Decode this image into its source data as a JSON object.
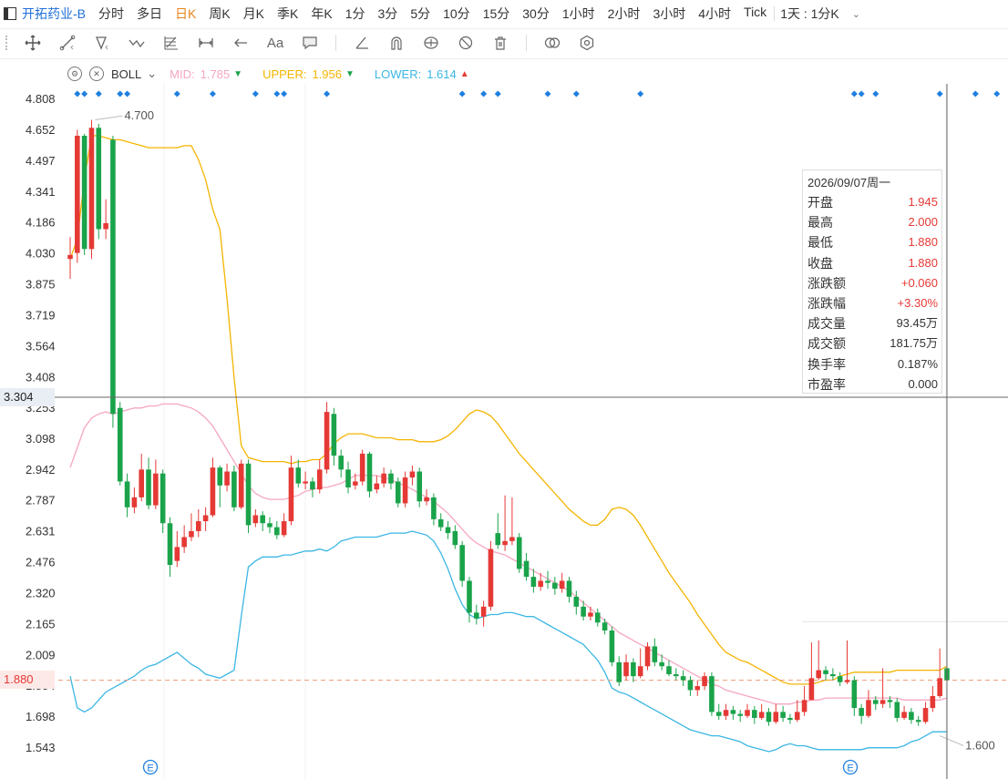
{
  "header": {
    "stock_name": "开拓药业-B",
    "periods": [
      "分时",
      "多日",
      "日K",
      "周K",
      "月K",
      "季K",
      "年K",
      "1分",
      "3分",
      "5分",
      "10分",
      "15分",
      "30分",
      "1小时",
      "2小时",
      "3小时",
      "4小时",
      "Tick"
    ],
    "active_period": "日K",
    "period_selector": "1天 : 1分K"
  },
  "toolbar": {
    "icons": [
      "crosshair-icon",
      "line-tool-icon",
      "shape-tool-icon",
      "wave-tool-icon",
      "fib-tool-icon",
      "measure-tool-icon",
      "arrow-tool-icon",
      "text-tool-icon",
      "comment-tool-icon",
      "angle-tool-icon",
      "magnet-icon",
      "lock-icon",
      "hide-icon",
      "trash-icon",
      "compare-icon",
      "settings-icon"
    ],
    "text_tool_label": "Aa"
  },
  "indicator": {
    "name": "BOLL",
    "mid_label": "MID:",
    "mid_value": "1.785",
    "upper_label": "UPPER:",
    "upper_value": "1.956",
    "lower_label": "LOWER:",
    "lower_value": "1.614",
    "mid_color": "#f5a7c0",
    "upper_color": "#f4b400",
    "lower_color": "#3bb6e3"
  },
  "infobox": {
    "date": "2026/09/07周一",
    "rows": [
      {
        "label": "开盘",
        "value": "1.945",
        "color": "#e53935"
      },
      {
        "label": "最高",
        "value": "2.000",
        "color": "#e53935"
      },
      {
        "label": "最低",
        "value": "1.880",
        "color": "#e53935"
      },
      {
        "label": "收盘",
        "value": "1.880",
        "color": "#e53935"
      },
      {
        "label": "涨跌额",
        "value": "+0.060",
        "color": "#e53935"
      },
      {
        "label": "涨跌幅",
        "value": "+3.30%",
        "color": "#e53935"
      },
      {
        "label": "成交量",
        "value": "93.45万",
        "color": "#333333"
      },
      {
        "label": "成交额",
        "value": "181.75万",
        "color": "#333333"
      },
      {
        "label": "换手率",
        "value": "0.187%",
        "color": "#333333"
      },
      {
        "label": "市盈率",
        "value": "0.000",
        "color": "#333333"
      }
    ]
  },
  "crosshair": {
    "price_label": "3.304",
    "last_price_label": "1.880"
  },
  "colors": {
    "up": "#e53935",
    "down": "#1aa34a",
    "accent": "#1e6fd9",
    "active_period": "#e8841a"
  },
  "chart_data": {
    "type": "candlestick",
    "y_tick_labels": [
      "4.808",
      "4.652",
      "4.497",
      "4.341",
      "4.186",
      "4.030",
      "3.875",
      "3.719",
      "3.564",
      "3.408",
      "3.253",
      "3.098",
      "2.942",
      "2.787",
      "2.631",
      "2.476",
      "2.320",
      "2.165",
      "2.009",
      "1.854",
      "1.698",
      "1.543"
    ],
    "ylim": [
      1.5,
      4.87
    ],
    "high_annotation": "4.700",
    "low_annotation": "1.600",
    "event_marker_label": "E",
    "candles": [
      [
        4.0,
        4.02,
        4.11,
        3.9
      ],
      [
        4.03,
        4.62,
        4.65,
        3.98
      ],
      [
        4.62,
        4.05,
        4.63,
        4.02
      ],
      [
        4.05,
        4.66,
        4.7,
        4.0
      ],
      [
        4.66,
        4.15,
        4.68,
        4.1
      ],
      [
        4.15,
        4.18,
        4.3,
        4.1
      ],
      [
        4.6,
        3.22,
        4.62,
        3.15
      ],
      [
        3.25,
        2.88,
        3.28,
        2.86
      ],
      [
        2.88,
        2.75,
        2.92,
        2.7
      ],
      [
        2.75,
        2.8,
        2.85,
        2.72
      ],
      [
        2.8,
        2.94,
        3.02,
        2.78
      ],
      [
        2.94,
        2.76,
        3.0,
        2.74
      ],
      [
        2.76,
        2.92,
        2.99,
        2.74
      ],
      [
        2.92,
        2.67,
        2.94,
        2.62
      ],
      [
        2.67,
        2.46,
        2.7,
        2.4
      ],
      [
        2.48,
        2.55,
        2.63,
        2.45
      ],
      [
        2.55,
        2.6,
        2.66,
        2.52
      ],
      [
        2.6,
        2.63,
        2.72,
        2.58
      ],
      [
        2.63,
        2.68,
        2.74,
        2.6
      ],
      [
        2.68,
        2.71,
        2.75,
        2.63
      ],
      [
        2.71,
        2.95,
        3.0,
        2.7
      ],
      [
        2.95,
        2.86,
        2.96,
        2.75
      ],
      [
        2.86,
        2.93,
        2.97,
        2.83
      ],
      [
        2.93,
        2.75,
        2.96,
        2.73
      ],
      [
        2.75,
        2.97,
        2.99,
        2.74
      ],
      [
        2.97,
        2.66,
        2.99,
        2.62
      ],
      [
        2.67,
        2.71,
        2.74,
        2.65
      ],
      [
        2.71,
        2.67,
        2.73,
        2.63
      ],
      [
        2.67,
        2.65,
        2.7,
        2.62
      ],
      [
        2.65,
        2.61,
        2.68,
        2.59
      ],
      [
        2.61,
        2.68,
        2.72,
        2.6
      ],
      [
        2.68,
        2.95,
        3.01,
        2.66
      ],
      [
        2.95,
        2.87,
        2.99,
        2.85
      ],
      [
        2.87,
        2.88,
        2.93,
        2.84
      ],
      [
        2.88,
        2.84,
        2.9,
        2.8
      ],
      [
        2.84,
        2.94,
        2.99,
        2.82
      ],
      [
        2.94,
        3.23,
        3.28,
        2.92
      ],
      [
        3.22,
        3.01,
        3.25,
        2.96
      ],
      [
        3.01,
        2.94,
        3.04,
        2.9
      ],
      [
        2.94,
        2.85,
        2.98,
        2.82
      ],
      [
        2.86,
        2.88,
        2.92,
        2.84
      ],
      [
        2.88,
        3.02,
        3.04,
        2.86
      ],
      [
        3.02,
        2.83,
        3.03,
        2.8
      ],
      [
        2.84,
        2.87,
        2.91,
        2.82
      ],
      [
        2.87,
        2.92,
        2.95,
        2.85
      ],
      [
        2.92,
        2.87,
        2.94,
        2.84
      ],
      [
        2.88,
        2.77,
        2.9,
        2.75
      ],
      [
        2.77,
        2.9,
        2.93,
        2.75
      ],
      [
        2.9,
        2.93,
        2.96,
        2.86
      ],
      [
        2.93,
        2.78,
        2.95,
        2.75
      ],
      [
        2.78,
        2.8,
        2.84,
        2.76
      ],
      [
        2.8,
        2.69,
        2.82,
        2.66
      ],
      [
        2.69,
        2.65,
        2.72,
        2.63
      ],
      [
        2.65,
        2.62,
        2.68,
        2.59
      ],
      [
        2.63,
        2.56,
        2.66,
        2.54
      ],
      [
        2.56,
        2.38,
        2.58,
        2.35
      ],
      [
        2.38,
        2.22,
        2.4,
        2.17
      ],
      [
        2.22,
        2.19,
        2.26,
        2.16
      ],
      [
        2.2,
        2.25,
        2.28,
        2.15
      ],
      [
        2.25,
        2.54,
        2.58,
        2.23
      ],
      [
        2.62,
        2.56,
        2.72,
        2.54
      ],
      [
        2.56,
        2.58,
        2.81,
        2.53
      ],
      [
        2.58,
        2.6,
        2.8,
        2.56
      ],
      [
        2.6,
        2.44,
        2.62,
        2.42
      ],
      [
        2.48,
        2.4,
        2.52,
        2.38
      ],
      [
        2.4,
        2.35,
        2.44,
        2.32
      ],
      [
        2.35,
        2.38,
        2.42,
        2.33
      ],
      [
        2.38,
        2.37,
        2.43,
        2.34
      ],
      [
        2.37,
        2.34,
        2.4,
        2.31
      ],
      [
        2.34,
        2.38,
        2.42,
        2.32
      ],
      [
        2.38,
        2.3,
        2.4,
        2.27
      ],
      [
        2.3,
        2.25,
        2.33,
        2.21
      ],
      [
        2.25,
        2.2,
        2.28,
        2.18
      ],
      [
        2.2,
        2.22,
        2.25,
        2.18
      ],
      [
        2.22,
        2.17,
        2.24,
        2.15
      ],
      [
        2.17,
        2.13,
        2.19,
        2.11
      ],
      [
        2.13,
        1.97,
        2.15,
        1.95
      ],
      [
        1.97,
        1.87,
        2.0,
        1.85
      ],
      [
        1.9,
        1.97,
        2.01,
        1.88
      ],
      [
        1.97,
        1.9,
        1.99,
        1.87
      ],
      [
        1.9,
        1.95,
        2.04,
        1.89
      ],
      [
        1.95,
        2.05,
        2.07,
        1.93
      ],
      [
        2.05,
        1.97,
        2.09,
        1.95
      ],
      [
        1.97,
        1.95,
        2.01,
        1.93
      ],
      [
        1.95,
        1.91,
        1.98,
        1.9
      ],
      [
        1.91,
        1.9,
        1.94,
        1.88
      ],
      [
        1.9,
        1.88,
        1.93,
        1.85
      ],
      [
        1.88,
        1.83,
        1.9,
        1.8
      ],
      [
        1.83,
        1.85,
        1.88,
        1.8
      ],
      [
        1.85,
        1.9,
        1.92,
        1.83
      ],
      [
        1.9,
        1.72,
        1.92,
        1.7
      ],
      [
        1.72,
        1.7,
        1.76,
        1.68
      ],
      [
        1.7,
        1.73,
        1.76,
        1.68
      ],
      [
        1.73,
        1.71,
        1.75,
        1.68
      ],
      [
        1.71,
        1.7,
        1.73,
        1.67
      ],
      [
        1.7,
        1.73,
        1.76,
        1.69
      ],
      [
        1.73,
        1.69,
        1.75,
        1.66
      ],
      [
        1.69,
        1.72,
        1.76,
        1.68
      ],
      [
        1.72,
        1.67,
        1.74,
        1.65
      ],
      [
        1.67,
        1.72,
        1.76,
        1.66
      ],
      [
        1.72,
        1.69,
        1.75,
        1.67
      ],
      [
        1.69,
        1.68,
        1.71,
        1.66
      ],
      [
        1.68,
        1.72,
        1.78,
        1.67
      ],
      [
        1.72,
        1.78,
        1.85,
        1.7
      ],
      [
        1.78,
        1.89,
        2.07,
        1.78
      ],
      [
        1.89,
        1.93,
        2.08,
        1.88
      ],
      [
        1.93,
        1.91,
        1.95,
        1.88
      ],
      [
        1.91,
        1.9,
        1.94,
        1.88
      ],
      [
        1.9,
        1.87,
        1.92,
        1.85
      ],
      [
        1.87,
        1.88,
        2.08,
        1.86
      ],
      [
        1.88,
        1.74,
        1.9,
        1.7
      ],
      [
        1.74,
        1.7,
        1.76,
        1.66
      ],
      [
        1.7,
        1.78,
        1.83,
        1.69
      ],
      [
        1.78,
        1.76,
        1.8,
        1.73
      ],
      [
        1.76,
        1.78,
        1.94,
        1.74
      ],
      [
        1.78,
        1.77,
        1.8,
        1.74
      ],
      [
        1.77,
        1.69,
        1.79,
        1.67
      ],
      [
        1.69,
        1.72,
        1.75,
        1.68
      ],
      [
        1.72,
        1.68,
        1.74,
        1.66
      ],
      [
        1.68,
        1.67,
        1.7,
        1.65
      ],
      [
        1.67,
        1.74,
        1.77,
        1.66
      ],
      [
        1.74,
        1.8,
        1.85,
        1.72
      ],
      [
        1.8,
        1.89,
        2.04,
        1.79
      ],
      [
        1.94,
        1.88,
        2.0,
        1.88
      ]
    ],
    "series": [
      {
        "name": "UPPER",
        "values": [
          4.0,
          4.1,
          4.4,
          4.62,
          4.62,
          4.61,
          4.6,
          4.6,
          4.59,
          4.58,
          4.57,
          4.56,
          4.56,
          4.56,
          4.56,
          4.56,
          4.57,
          4.57,
          4.5,
          4.4,
          4.25,
          4.15,
          3.8,
          3.4,
          3.06,
          3.0,
          2.99,
          2.98,
          2.98,
          2.98,
          2.98,
          2.97,
          2.98,
          2.98,
          2.99,
          2.99,
          3.02,
          3.07,
          3.1,
          3.12,
          3.12,
          3.12,
          3.11,
          3.1,
          3.1,
          3.1,
          3.09,
          3.09,
          3.09,
          3.08,
          3.08,
          3.08,
          3.09,
          3.11,
          3.14,
          3.18,
          3.22,
          3.24,
          3.23,
          3.21,
          3.17,
          3.12,
          3.07,
          3.02,
          2.98,
          2.94,
          2.9,
          2.86,
          2.82,
          2.78,
          2.74,
          2.71,
          2.68,
          2.66,
          2.66,
          2.69,
          2.74,
          2.75,
          2.74,
          2.71,
          2.66,
          2.6,
          2.54,
          2.48,
          2.42,
          2.37,
          2.32,
          2.27,
          2.21,
          2.16,
          2.11,
          2.06,
          2.02,
          2.0,
          1.98,
          1.97,
          1.95,
          1.93,
          1.91,
          1.89,
          1.87,
          1.86,
          1.86,
          1.86,
          1.86,
          1.87,
          1.88,
          1.88,
          1.9,
          1.91,
          1.92,
          1.92,
          1.92,
          1.92,
          1.92,
          1.92,
          1.93,
          1.93,
          1.93,
          1.93,
          1.93,
          1.93,
          1.93,
          1.95
        ]
      },
      {
        "name": "MID",
        "values": [
          2.95,
          3.05,
          3.15,
          3.2,
          3.22,
          3.23,
          3.22,
          3.23,
          3.24,
          3.25,
          3.25,
          3.26,
          3.26,
          3.27,
          3.27,
          3.27,
          3.26,
          3.25,
          3.23,
          3.2,
          3.16,
          3.1,
          3.04,
          2.98,
          2.92,
          2.86,
          2.82,
          2.8,
          2.79,
          2.79,
          2.79,
          2.8,
          2.81,
          2.83,
          2.84,
          2.85,
          2.85,
          2.86,
          2.87,
          2.89,
          2.91,
          2.91,
          2.91,
          2.91,
          2.9,
          2.89,
          2.87,
          2.86,
          2.84,
          2.82,
          2.8,
          2.78,
          2.75,
          2.72,
          2.68,
          2.64,
          2.6,
          2.57,
          2.55,
          2.53,
          2.52,
          2.51,
          2.49,
          2.47,
          2.45,
          2.43,
          2.41,
          2.39,
          2.37,
          2.35,
          2.33,
          2.3,
          2.27,
          2.24,
          2.21,
          2.18,
          2.15,
          2.12,
          2.1,
          2.08,
          2.06,
          2.04,
          2.02,
          2.0,
          1.98,
          1.96,
          1.94,
          1.92,
          1.9,
          1.88,
          1.86,
          1.85,
          1.83,
          1.82,
          1.81,
          1.8,
          1.79,
          1.78,
          1.77,
          1.76,
          1.76,
          1.76,
          1.77,
          1.77,
          1.78,
          1.78,
          1.79,
          1.79,
          1.79,
          1.79,
          1.79,
          1.79,
          1.79,
          1.79,
          1.79,
          1.79,
          1.79,
          1.78,
          1.78,
          1.78,
          1.78,
          1.78,
          1.78,
          1.79
        ]
      },
      {
        "name": "LOWER",
        "values": [
          1.9,
          1.74,
          1.72,
          1.74,
          1.78,
          1.82,
          1.84,
          1.86,
          1.88,
          1.9,
          1.93,
          1.95,
          1.96,
          1.98,
          2.0,
          2.02,
          1.99,
          1.96,
          1.94,
          1.91,
          1.9,
          1.89,
          1.91,
          1.93,
          2.2,
          2.45,
          2.48,
          2.5,
          2.5,
          2.5,
          2.51,
          2.51,
          2.52,
          2.53,
          2.53,
          2.54,
          2.53,
          2.55,
          2.58,
          2.59,
          2.6,
          2.6,
          2.6,
          2.6,
          2.61,
          2.62,
          2.62,
          2.62,
          2.63,
          2.62,
          2.61,
          2.58,
          2.52,
          2.44,
          2.34,
          2.26,
          2.21,
          2.19,
          2.2,
          2.21,
          2.21,
          2.22,
          2.22,
          2.21,
          2.2,
          2.2,
          2.18,
          2.16,
          2.14,
          2.12,
          2.1,
          2.08,
          2.06,
          2.02,
          1.98,
          1.92,
          1.84,
          1.82,
          1.81,
          1.79,
          1.77,
          1.75,
          1.73,
          1.71,
          1.69,
          1.67,
          1.65,
          1.63,
          1.62,
          1.61,
          1.6,
          1.6,
          1.59,
          1.58,
          1.57,
          1.55,
          1.54,
          1.53,
          1.52,
          1.53,
          1.55,
          1.56,
          1.55,
          1.55,
          1.54,
          1.53,
          1.53,
          1.53,
          1.53,
          1.53,
          1.53,
          1.53,
          1.54,
          1.54,
          1.54,
          1.54,
          1.54,
          1.55,
          1.57,
          1.58,
          1.6,
          1.62,
          1.62,
          1.62
        ]
      }
    ],
    "signal_marker_indices": [
      1,
      2,
      4,
      7,
      8,
      15,
      20,
      26,
      29,
      30,
      36,
      55,
      58,
      60,
      67,
      71,
      80,
      110,
      111,
      113,
      122,
      127,
      130
    ]
  }
}
